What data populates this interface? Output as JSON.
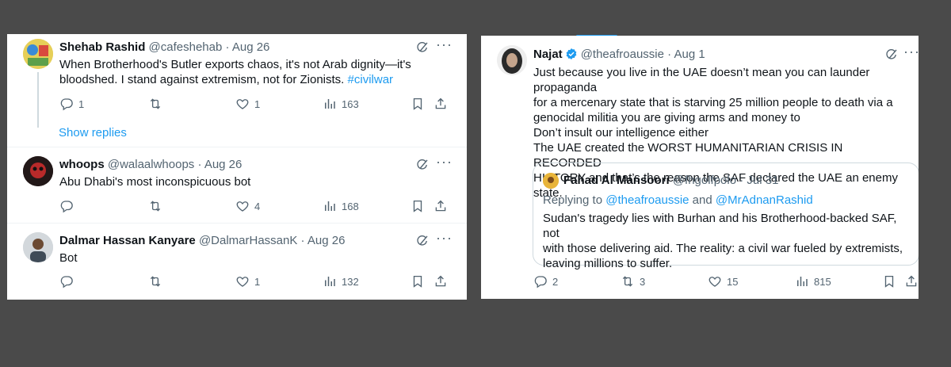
{
  "left_panel": {
    "tweets": [
      {
        "name": "Shehab Rashid",
        "handle": "@cafeshehab",
        "separator": "·",
        "date": "Aug 26",
        "text_line1": "When Brotherhood's Butler exports chaos, it's not Arab dignity—it's",
        "text_line2": "bloodshed. I stand against extremism, not for Zionists. ",
        "hashtag": "#civilwar",
        "replies": "1",
        "reposts": "",
        "likes": "1",
        "views": "163"
      },
      {
        "name": "whoops",
        "handle": "@walaalwhoops",
        "separator": "·",
        "date": "Aug 26",
        "text_line1": "Abu Dhabi's most inconspicuous bot",
        "replies": "",
        "reposts": "",
        "likes": "4",
        "views": "168"
      },
      {
        "name": "Dalmar Hassan Kanyare",
        "handle": "@DalmarHassanK",
        "separator": "·",
        "date": "Aug 26",
        "text_line1": "Bot",
        "replies": "",
        "reposts": "",
        "likes": "1",
        "views": "132"
      }
    ],
    "show_replies": "Show replies"
  },
  "right_panel": {
    "tweet": {
      "name": "Najat",
      "handle": "@theafroaussie",
      "separator": "·",
      "date": "Aug 1",
      "lines": [
        "Just because you live in the UAE doesn’t mean you can launder propaganda",
        "for a mercenary state that is starving 25 million people to death via a",
        "genocidal militia you are giving arms and money to",
        "Don’t insult our intelligence either",
        "The UAE created the WORST HUMANITARIAN CRISIS IN RECORDED",
        "HISTORY and that’s the reason the SAF declared the UAE an enemy state."
      ],
      "replies": "2",
      "reposts": "3",
      "likes": "15",
      "views": "815"
    },
    "quote": {
      "name": "Fahad Al Mansoori",
      "handle": "@fhgolfpolo",
      "separator": "·",
      "date": "Jul 31",
      "replying_prefix": "Replying to ",
      "mention1": "@theafroaussie",
      "and": " and ",
      "mention2": "@MrAdnanRashid",
      "lines": [
        "Sudan's tragedy lies with Burhan and his Brotherhood-backed SAF, not",
        "with those delivering aid. The reality: a civil war fueled by extremists,",
        "leaving millions to suffer."
      ]
    }
  },
  "colors": {
    "accent": "#1d9bf0",
    "secondary_text": "#536471",
    "background": "#4a4a4a"
  },
  "icons": [
    "reply-icon",
    "repost-icon",
    "like-icon",
    "views-icon",
    "bookmark-icon",
    "share-icon",
    "grok-icon",
    "more-icon",
    "verified-icon"
  ]
}
